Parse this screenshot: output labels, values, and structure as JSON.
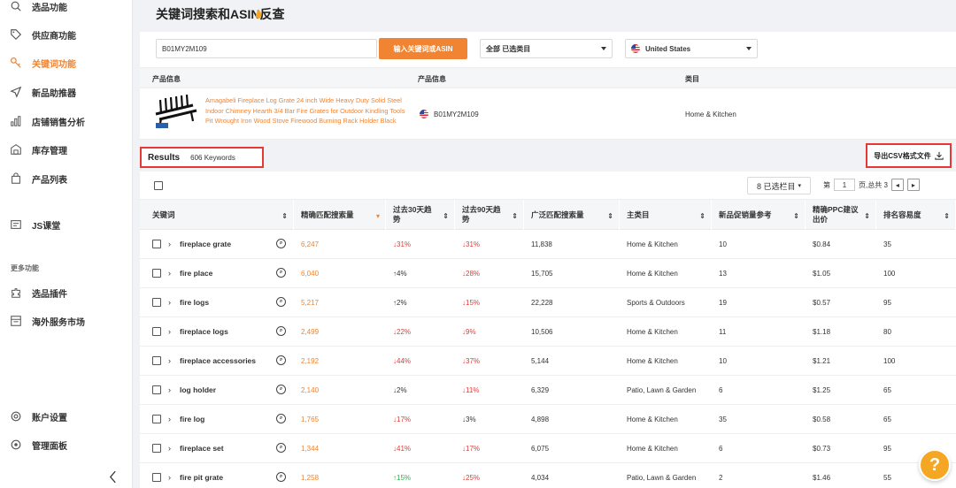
{
  "sidebar": {
    "items": [
      {
        "label": "选品功能",
        "icon": "search-icon"
      },
      {
        "label": "供应商功能",
        "icon": "tag-icon"
      },
      {
        "label": "关键词功能",
        "icon": "key-icon",
        "active": true
      },
      {
        "label": "新品助推器",
        "icon": "send-icon"
      },
      {
        "label": "店铺销售分析",
        "icon": "bar-chart-icon"
      },
      {
        "label": "库存管理",
        "icon": "warehouse-icon"
      },
      {
        "label": "产品列表",
        "icon": "bag-icon"
      },
      {
        "label": "JS课堂",
        "icon": "classroom-icon"
      },
      {
        "label": "选品插件",
        "icon": "plugin-icon"
      },
      {
        "label": "海外服务市场",
        "icon": "market-icon"
      },
      {
        "label": "账户设置",
        "icon": "gear-icon"
      },
      {
        "label": "管理面板",
        "icon": "panel-icon"
      }
    ],
    "section_more": "更多功能"
  },
  "page": {
    "title": "关键词搜索和ASIN反查"
  },
  "search": {
    "value": "B01MY2M109",
    "button": "输入关键词或ASIN",
    "category_select": "全部 已选类目",
    "market_select": "United States"
  },
  "product_table": {
    "headers": [
      "产品信息",
      "产品信息",
      "类目"
    ],
    "title": "Amagabeli Fireplace Log Grate 24 inch Wide Heavy Duty Solid Steel Indoor Chimney Hearth 3/4 Bar Fire Grates for Outdoor Kindling Tools Pit Wrought Iron Wood Stove Firewood Burning Rack Holder Black",
    "asin": "B01MY2M109",
    "category": "Home & Kitchen"
  },
  "results": {
    "label": "Results",
    "count": "606 Keywords",
    "export": "导出CSV格式文件"
  },
  "toolbar": {
    "columns_select": "8 已选栏目",
    "page_prefix": "第",
    "page_value": "1",
    "page_suffix": "页,总共 3"
  },
  "table": {
    "headers": [
      "关键词",
      "精确匹配搜索量",
      "过去30天趋势",
      "过去90天趋势",
      "广泛匹配搜索量",
      "主类目",
      "新品促销量参考",
      "精确PPC建议出价",
      "排名容易度"
    ],
    "rows": [
      {
        "keyword": "fireplace grate",
        "exact": "6,247",
        "t30": "31%",
        "t30dir": "down",
        "t90": "31%",
        "t90dir": "down",
        "broad": "11,838",
        "category": "Home & Kitchen",
        "promo": "10",
        "ppc": "$0.84",
        "ease": "35"
      },
      {
        "keyword": "fire place",
        "exact": "6,040",
        "t30": "4%",
        "t30dir": "upflat",
        "t90": "28%",
        "t90dir": "down",
        "broad": "15,705",
        "category": "Home & Kitchen",
        "promo": "13",
        "ppc": "$1.05",
        "ease": "100"
      },
      {
        "keyword": "fire logs",
        "exact": "5,217",
        "t30": "2%",
        "t30dir": "upflat",
        "t90": "15%",
        "t90dir": "down",
        "broad": "22,228",
        "category": "Sports & Outdoors",
        "promo": "19",
        "ppc": "$0.57",
        "ease": "95"
      },
      {
        "keyword": "fireplace logs",
        "exact": "2,499",
        "t30": "22%",
        "t30dir": "down",
        "t90": "9%",
        "t90dir": "down",
        "broad": "10,506",
        "category": "Home & Kitchen",
        "promo": "11",
        "ppc": "$1.18",
        "ease": "80"
      },
      {
        "keyword": "fireplace accessories",
        "exact": "2,192",
        "t30": "44%",
        "t30dir": "down",
        "t90": "37%",
        "t90dir": "down",
        "broad": "5,144",
        "category": "Home & Kitchen",
        "promo": "10",
        "ppc": "$1.21",
        "ease": "100"
      },
      {
        "keyword": "log holder",
        "exact": "2,140",
        "t30": "2%",
        "t30dir": "downflat",
        "t90": "11%",
        "t90dir": "down",
        "broad": "6,329",
        "category": "Patio, Lawn & Garden",
        "promo": "6",
        "ppc": "$1.25",
        "ease": "65"
      },
      {
        "keyword": "fire log",
        "exact": "1,765",
        "t30": "17%",
        "t30dir": "down",
        "t90": "3%",
        "t90dir": "downflat",
        "broad": "4,898",
        "category": "Home & Kitchen",
        "promo": "35",
        "ppc": "$0.58",
        "ease": "65"
      },
      {
        "keyword": "fireplace set",
        "exact": "1,344",
        "t30": "41%",
        "t30dir": "down",
        "t90": "17%",
        "t90dir": "down",
        "broad": "6,075",
        "category": "Home & Kitchen",
        "promo": "6",
        "ppc": "$0.73",
        "ease": "95"
      },
      {
        "keyword": "fire pit grate",
        "exact": "1,258",
        "t30": "15%",
        "t30dir": "up",
        "t90": "25%",
        "t90dir": "down",
        "broad": "4,034",
        "category": "Patio, Lawn & Garden",
        "promo": "2",
        "ppc": "$1.46",
        "ease": "55"
      }
    ]
  },
  "colors": {
    "accent": "#f08432",
    "down": "#e53935",
    "up": "#2bb24c",
    "highlight_border": "#e53935"
  }
}
